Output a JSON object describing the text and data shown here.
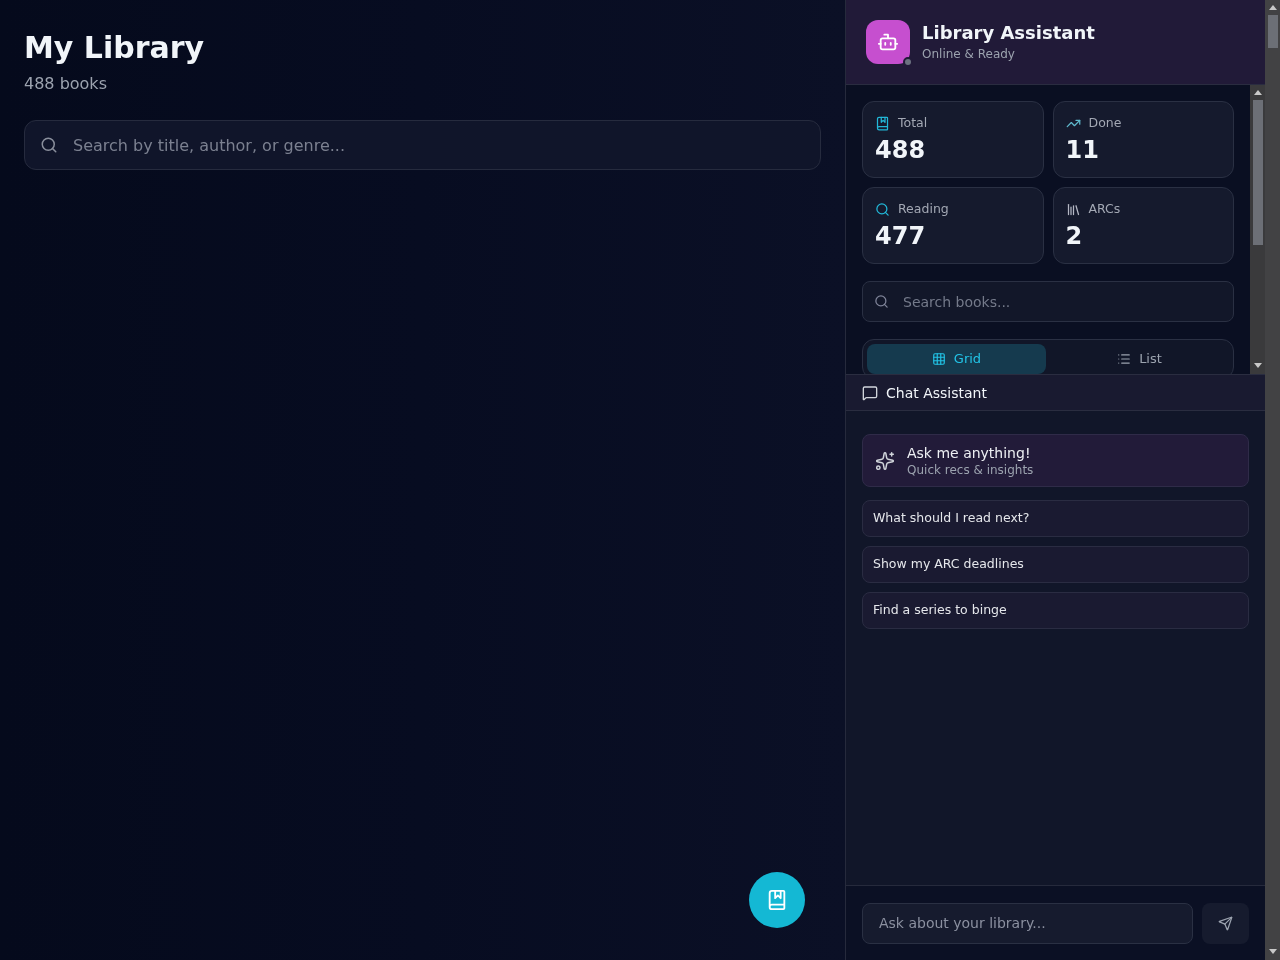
{
  "library": {
    "title": "My Library",
    "count": "488 books",
    "search": {
      "placeholder": "Search by title, author, or genre..."
    }
  },
  "assistant": {
    "title": "Library Assistant",
    "status": "Online & Ready"
  },
  "stats": [
    {
      "kind": "total",
      "label": "Total",
      "value": "488"
    },
    {
      "kind": "done",
      "label": "Done",
      "value": "11"
    },
    {
      "kind": "reading",
      "label": "Reading",
      "value": "477"
    },
    {
      "kind": "arcs",
      "label": "ARCs",
      "value": "2"
    }
  ],
  "book_search": {
    "placeholder": "Search books..."
  },
  "view_tabs": [
    {
      "kind": "grid",
      "label": "Grid",
      "selected": true
    },
    {
      "kind": "list",
      "label": "List",
      "selected": false
    }
  ],
  "chat": {
    "title": "Chat Assistant",
    "intro": {
      "title": "Ask me anything!",
      "subtitle": "Quick recs & insights"
    },
    "suggestions": [
      "What should I read next?",
      "Show my ARC deadlines",
      "Find a series to binge"
    ],
    "input": {
      "placeholder": "Ask about your library..."
    }
  }
}
